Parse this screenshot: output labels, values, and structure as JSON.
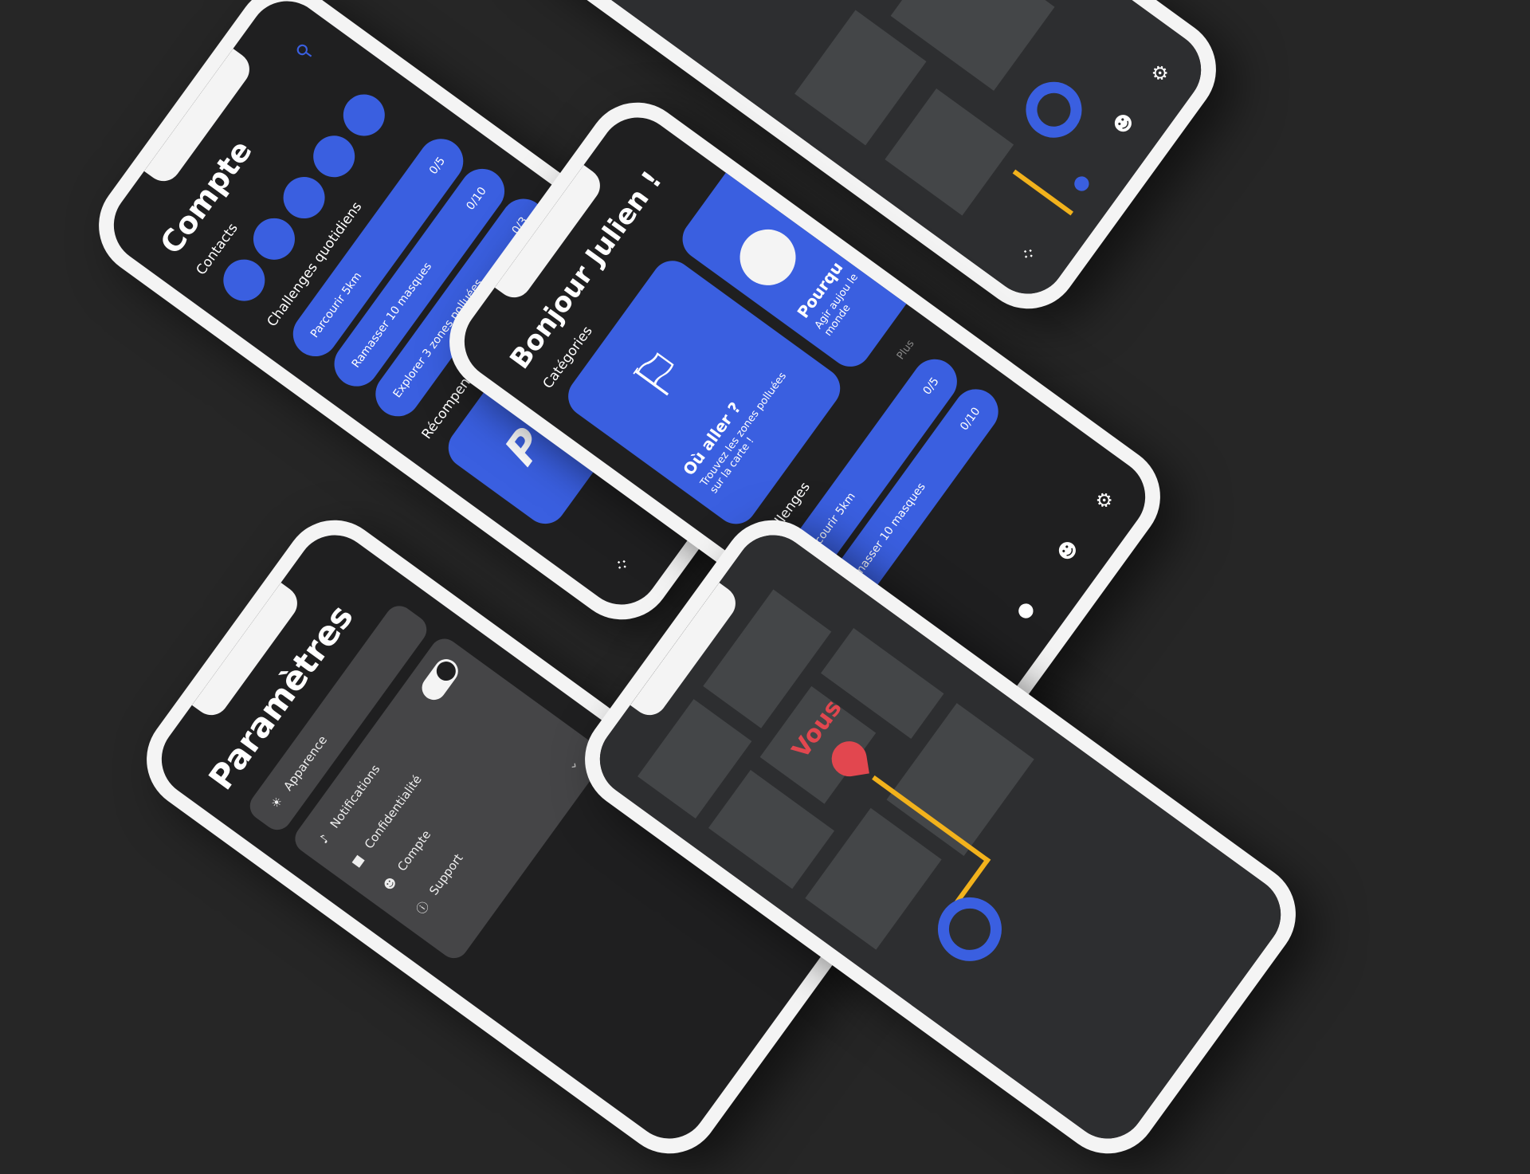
{
  "account": {
    "title": "Compte",
    "contacts_label": "Contacts",
    "challenges_label": "Challenges quotidiens",
    "challenges": [
      {
        "label": "Parcourir 5km",
        "progress": "0/5"
      },
      {
        "label": "Ramasser 10 masques",
        "progress": "0/10"
      },
      {
        "label": "Explorer 3 zones polluées",
        "progress": "0/3"
      }
    ],
    "rewards_label": "Récompenses"
  },
  "home": {
    "title": "Bonjour Julien !",
    "categories_label": "Catégories",
    "card1_title": "Où aller ?",
    "card1_text": "Trouvez les zones polluées sur la carte !",
    "card2_title": "Pourqu",
    "card2_text": "Agir aujou le monde",
    "challenges_label": "Challenges",
    "challenges": [
      {
        "label": "Parcourir 5km",
        "progress": "0/5"
      },
      {
        "label": "Ramasser 10 masques",
        "progress": "0/10"
      }
    ],
    "more_label": "Plus"
  },
  "settings": {
    "title": "Paramètres",
    "items": [
      {
        "label": "Apparence"
      },
      {
        "label": "Notifications"
      },
      {
        "label": "Confidentialité"
      },
      {
        "label": "Compte"
      },
      {
        "label": "Support"
      }
    ]
  },
  "map": {
    "you_label": "Vous"
  },
  "colors": {
    "accent": "#3a5fe0",
    "route": "#f2b21c",
    "marker": "#e2474f",
    "background": "#262626"
  }
}
